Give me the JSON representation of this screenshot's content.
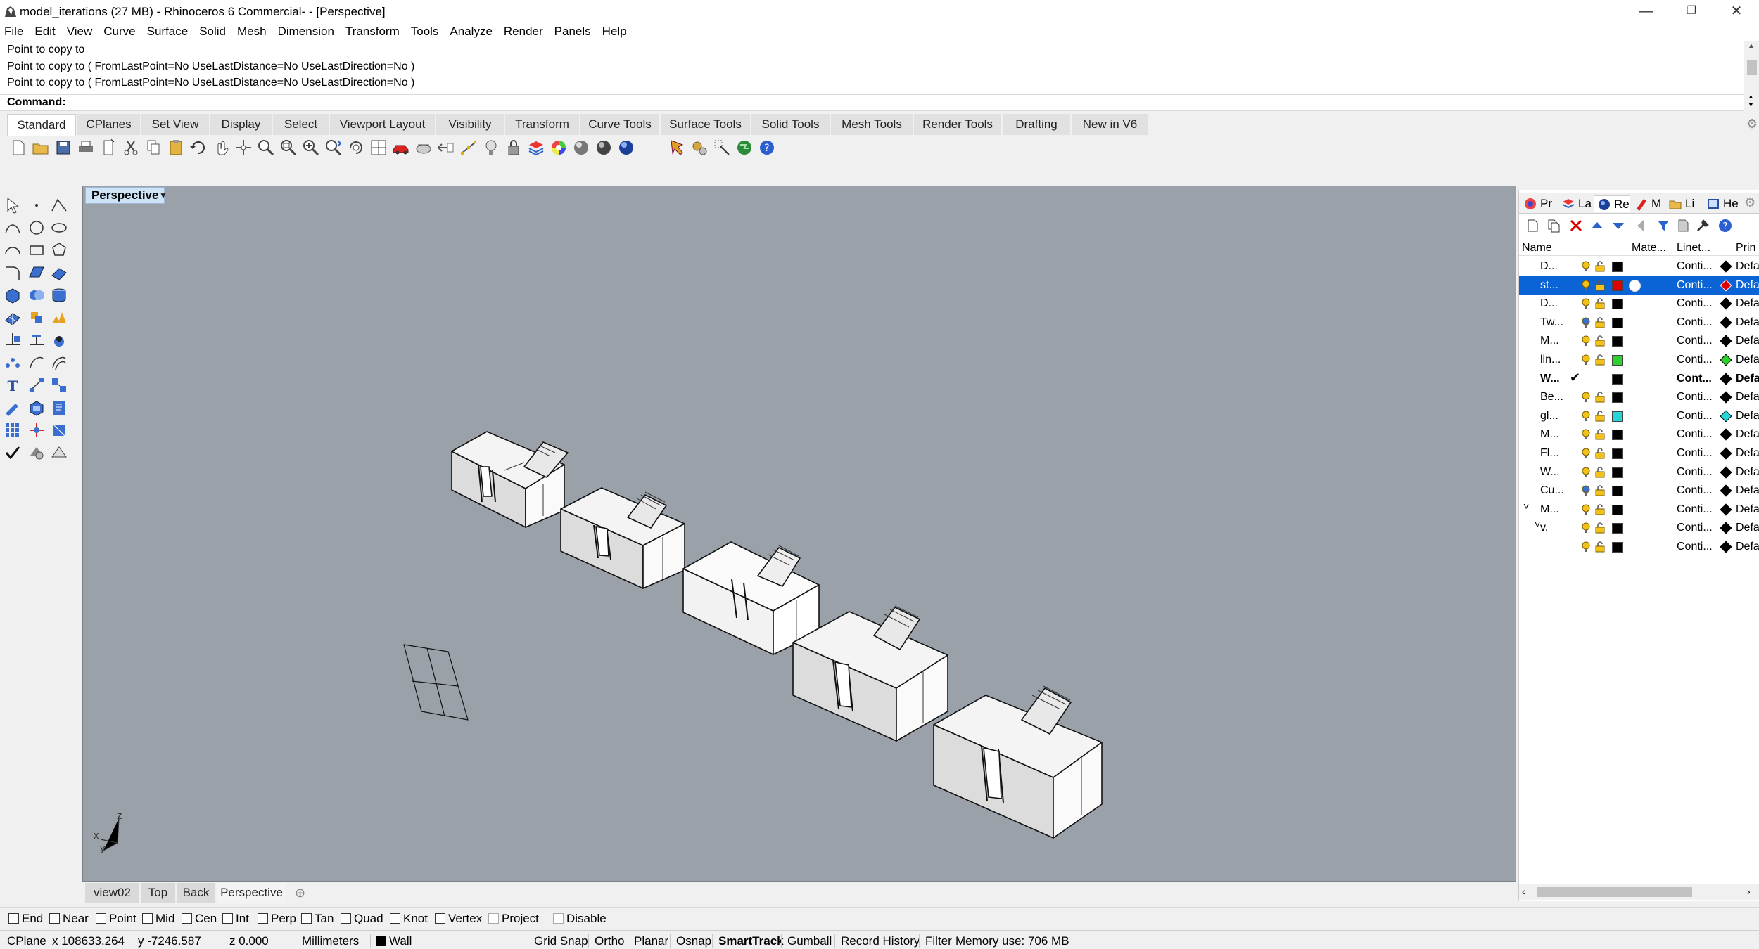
{
  "window": {
    "title": "model_iterations (27 MB) - Rhinoceros 6 Commercial- - [Perspective]",
    "minimize": "—",
    "restore": "❐",
    "close": "✕"
  },
  "menu": [
    "File",
    "Edit",
    "View",
    "Curve",
    "Surface",
    "Solid",
    "Mesh",
    "Dimension",
    "Transform",
    "Tools",
    "Analyze",
    "Render",
    "Panels",
    "Help"
  ],
  "history": [
    "Point to copy to",
    "Point to copy to ( FromLastPoint=No  UseLastDistance=No  UseLastDirection=No )",
    "Point to copy to ( FromLastPoint=No  UseLastDistance=No  UseLastDirection=No )"
  ],
  "command": {
    "label": "Command:",
    "value": ""
  },
  "toolbar_tabs": [
    "Standard",
    "CPlanes",
    "Set View",
    "Display",
    "Select",
    "Viewport Layout",
    "Visibility",
    "Transform",
    "Curve Tools",
    "Surface Tools",
    "Solid Tools",
    "Mesh Tools",
    "Render Tools",
    "Drafting",
    "New in V6"
  ],
  "viewport": {
    "name": "Perspective",
    "axis_x": "x",
    "axis_y": "y",
    "axis_z": "z"
  },
  "viewport_tabs": [
    "view02",
    "Top",
    "Back",
    "Perspective"
  ],
  "viewport_tab_add": "⊕",
  "osnaps": [
    {
      "label": "End"
    },
    {
      "label": "Near"
    },
    {
      "label": "Point"
    },
    {
      "label": "Mid"
    },
    {
      "label": "Cen"
    },
    {
      "label": "Int"
    },
    {
      "label": "Perp"
    },
    {
      "label": "Tan"
    },
    {
      "label": "Quad"
    },
    {
      "label": "Knot"
    },
    {
      "label": "Vertex"
    },
    {
      "label": "Project"
    },
    {
      "label": "Disable"
    }
  ],
  "status": {
    "cplane": "CPlane",
    "x": "x 108633.264",
    "y": "y -7246.587",
    "z": "z 0.000",
    "units": "Millimeters",
    "layer": "Wall",
    "grid_snap": "Grid Snap",
    "ortho": "Ortho",
    "planar": "Planar",
    "osnap": "Osnap",
    "smarttrack": "SmartTrack",
    "gumball": "Gumball",
    "record_history": "Record History",
    "filter": "Filter",
    "memory": "Memory use: 706 MB"
  },
  "panel": {
    "tabs": [
      "Pr",
      "La",
      "Re",
      "M",
      "Li",
      "He"
    ],
    "columns": {
      "name": "Name",
      "material": "Mate...",
      "linetype": "Linet...",
      "print": "Prin"
    },
    "layers": [
      {
        "name": "D...",
        "color": "#000000",
        "linetype": "Conti...",
        "print": "Defa",
        "print_color": "#000000"
      },
      {
        "name": "st...",
        "color": "#e00000",
        "linetype": "Conti...",
        "print": "Defa",
        "print_color": "#e00000",
        "selected": true
      },
      {
        "name": "D...",
        "color": "#000000",
        "linetype": "Conti...",
        "print": "Defa",
        "print_color": "#000000"
      },
      {
        "name": "Tw...",
        "color": "#000000",
        "linetype": "Conti...",
        "print": "Defa",
        "print_color": "#000000"
      },
      {
        "name": "M...",
        "color": "#000000",
        "linetype": "Conti...",
        "print": "Defa",
        "print_color": "#000000"
      },
      {
        "name": "lin...",
        "color": "#2fd12f",
        "linetype": "Conti...",
        "print": "Defa",
        "print_color": "#2fd12f"
      },
      {
        "name": "W...",
        "color": "#000000",
        "linetype": "Cont...",
        "print": "Defa",
        "print_color": "#000000",
        "current": true,
        "check": "✔"
      },
      {
        "name": "Be...",
        "color": "#000000",
        "linetype": "Conti...",
        "print": "Defa",
        "print_color": "#000000"
      },
      {
        "name": "gl...",
        "color": "#26d6d6",
        "linetype": "Conti...",
        "print": "Defa",
        "print_color": "#26d6d6"
      },
      {
        "name": "M...",
        "color": "#000000",
        "linetype": "Conti...",
        "print": "Defa",
        "print_color": "#000000"
      },
      {
        "name": "Fl...",
        "color": "#000000",
        "linetype": "Conti...",
        "print": "Defa",
        "print_color": "#000000"
      },
      {
        "name": "W...",
        "color": "#000000",
        "linetype": "Conti...",
        "print": "Defa",
        "print_color": "#000000"
      },
      {
        "name": "Cu...",
        "color": "#000000",
        "linetype": "Conti...",
        "print": "Defa",
        "print_color": "#000000"
      },
      {
        "name": "M...",
        "color": "#000000",
        "linetype": "Conti...",
        "print": "Defa",
        "print_color": "#000000",
        "chevron": "˅"
      },
      {
        "name": "v.",
        "color": "#000000",
        "linetype": "Conti...",
        "print": "Defa",
        "print_color": "#000000",
        "chevron": "˅"
      },
      {
        "name": "",
        "color": "#000000",
        "linetype": "Conti...",
        "print": "Defa",
        "print_color": "#000000"
      }
    ]
  }
}
